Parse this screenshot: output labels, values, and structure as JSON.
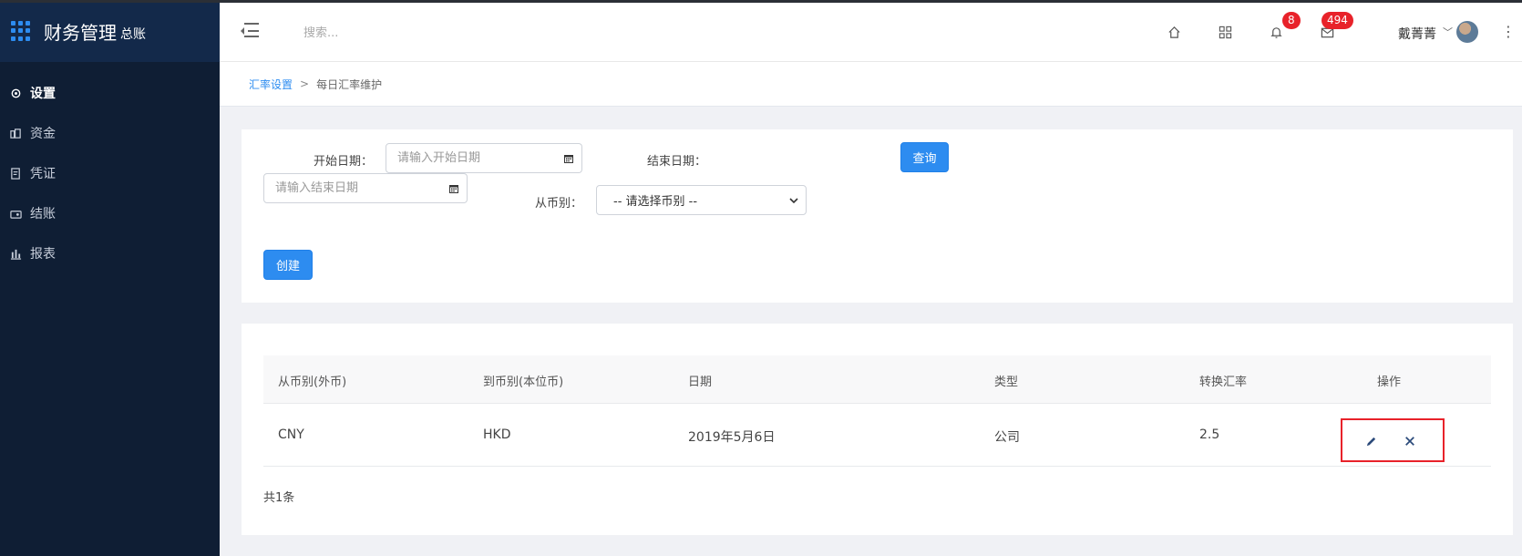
{
  "app": {
    "title": "财务管理",
    "subtitle": "总账"
  },
  "sidebar": {
    "items": [
      {
        "label": "设置",
        "icon": "gear-icon",
        "active": true
      },
      {
        "label": "资金",
        "icon": "cash-icon",
        "active": false
      },
      {
        "label": "凭证",
        "icon": "voucher-icon",
        "active": false
      },
      {
        "label": "结账",
        "icon": "wallet-icon",
        "active": false
      },
      {
        "label": "报表",
        "icon": "bar-chart-icon",
        "active": false
      }
    ]
  },
  "header": {
    "search_placeholder": "搜索...",
    "notifications_count": "8",
    "messages_count": "494",
    "user_name": "戴菁菁"
  },
  "breadcrumb": {
    "parent": "汇率设置",
    "separator": ">",
    "current": "每日汇率维护"
  },
  "filter": {
    "start_date_label": "开始日期：",
    "start_date_placeholder": "请输入开始日期",
    "end_date_label": "结束日期：",
    "end_date_placeholder": "请输入结束日期",
    "currency_label": "从币别：",
    "currency_selected": "-- 请选择币别 --",
    "query_button": "查询",
    "create_button": "创建"
  },
  "table": {
    "columns": [
      "从币别(外币)",
      "到币别(本位币)",
      "日期",
      "类型",
      "转换汇率",
      "操作"
    ],
    "rows": [
      {
        "from": "CNY",
        "to": "HKD",
        "date": "2019年5月6日",
        "type": "公司",
        "rate": "2.5"
      }
    ],
    "total": "共1条"
  },
  "colors": {
    "accent": "#2d8cf0",
    "sidebar_bg": "#0f1e34",
    "badge": "#e8222a",
    "highlight_box": "#e8222a"
  }
}
